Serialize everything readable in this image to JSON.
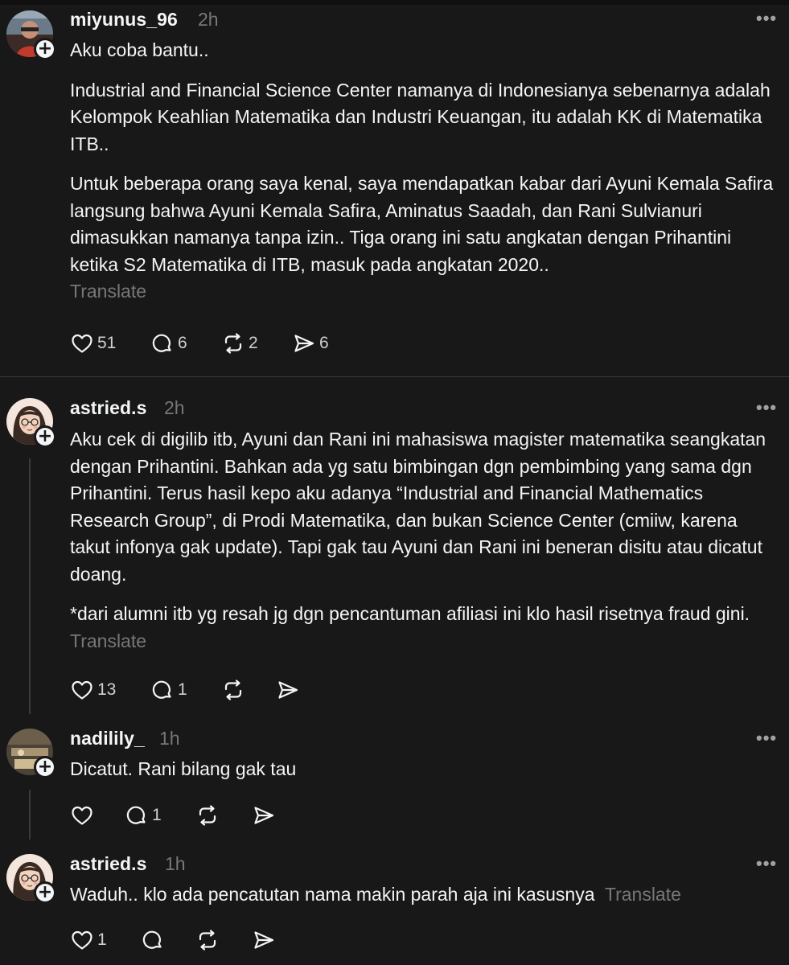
{
  "posts": [
    {
      "username": "miyunus_96",
      "time": "2h",
      "paragraphs": [
        "Aku coba bantu..",
        "Industrial and Financial Science Center namanya di Indonesianya sebenarnya adalah Kelompok Keahlian Matematika dan Industri Keuangan, itu adalah KK di Matematika ITB..",
        "Untuk beberapa orang saya kenal, saya mendapatkan kabar dari Ayuni Kemala Safira langsung bahwa Ayuni Kemala Safira, Aminatus Saadah, dan Rani Sulvianuri dimasukkan namanya tanpa izin.. Tiga orang ini satu angkatan dengan Prihantini ketika S2 Matematika di ITB, masuk pada angkatan 2020.."
      ],
      "translate": "Translate",
      "likes": "51",
      "replies": "6",
      "reposts": "2",
      "shares": "6"
    },
    {
      "username": "astried.s",
      "time": "2h",
      "paragraphs": [
        "Aku cek di digilib itb, Ayuni dan Rani ini mahasiswa magister matematika seangkatan dengan Prihantini. Bahkan ada yg satu bimbingan dgn pembimbing yang sama dgn Prihantini. Terus hasil kepo aku adanya “Industrial and Financial Mathematics Research Group”, di Prodi Matematika, dan bukan Science Center (cmiiw, karena takut infonya gak update). Tapi gak tau Ayuni dan Rani ini beneran disitu atau dicatut doang.",
        "*dari alumni itb yg resah jg dgn pencantuman afiliasi ini klo hasil risetnya fraud gini."
      ],
      "translate": "Translate",
      "likes": "13",
      "replies": "1"
    },
    {
      "username": "nadilily_",
      "time": "1h",
      "paragraphs": [
        "Dicatut. Rani bilang gak tau"
      ],
      "replies": "1"
    },
    {
      "username": "astried.s",
      "time": "1h",
      "paragraphs": [
        "Waduh.. klo ada pencatutan nama makin parah aja ini kasusnya"
      ],
      "translate": "Translate",
      "likes": "1"
    }
  ],
  "ui": {
    "more": "•••",
    "plus": "+"
  }
}
